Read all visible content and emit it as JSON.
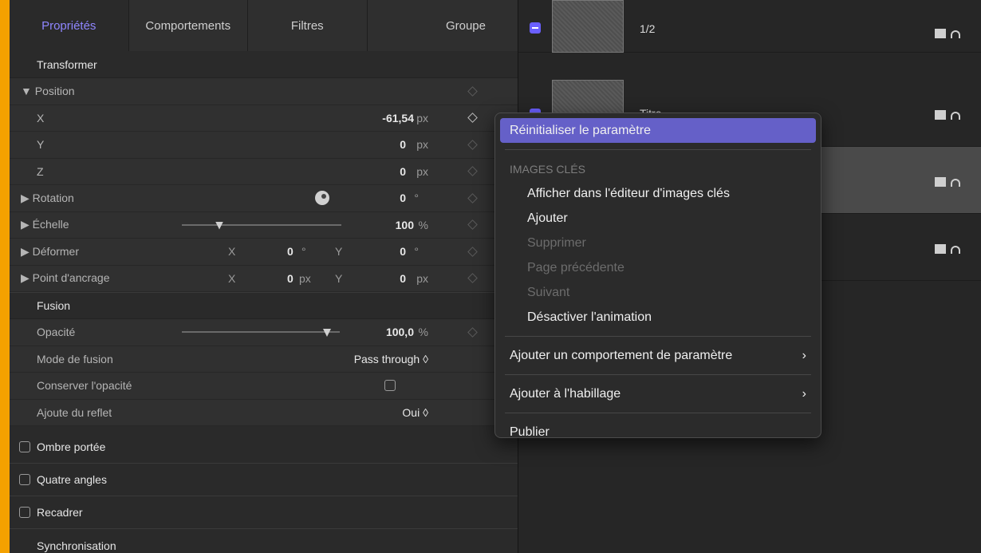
{
  "tabs": [
    "Propriétés",
    "Comportements",
    "Filtres",
    "Groupe"
  ],
  "inspector": {
    "transform_head": "Transformer",
    "position_label": "▼ Position",
    "x_label": "X",
    "x_value": "-61,54",
    "x_unit": "px",
    "y_label": "Y",
    "y_value": "0",
    "y_unit": "px",
    "z_label": "Z",
    "z_value": "0",
    "z_unit": "px",
    "rotation_label": "▶ Rotation",
    "rotation_value": "0",
    "rotation_unit": "°",
    "scale_label": "▶ Échelle",
    "scale_value": "100",
    "scale_unit": "%",
    "deform_label": "▶ Déformer",
    "deform_x_label": "X",
    "deform_x_value": "0",
    "deform_x_unit": "°",
    "deform_y_label": "Y",
    "deform_y_value": "0",
    "deform_y_unit": "°",
    "anchor_label": "▶ Point d'ancrage",
    "anchor_x_label": "X",
    "anchor_x_value": "0",
    "anchor_x_unit": "px",
    "anchor_y_label": "Y",
    "anchor_y_value": "0",
    "anchor_y_unit": "px",
    "fusion_head": "Fusion",
    "opacity_label": "Opacité",
    "opacity_value": "100,0",
    "opacity_unit": "%",
    "blend_label": "Mode de fusion",
    "blend_value": "Pass through ◊",
    "keep_opacity_label": "Conserver l'opacité",
    "reflection_label": "Ajoute du reflet",
    "reflection_value": "Oui ◊",
    "groups": [
      "Ombre portée",
      "Quatre angles",
      "Recadrer"
    ],
    "sync_label": "Synchronisation"
  },
  "layers": [
    {
      "name": "1/2"
    },
    {
      "name": "Titre"
    },
    {
      "name": ""
    },
    {
      "name": ""
    }
  ],
  "menu": {
    "reset": "Réinitialiser le paramètre",
    "keyframes_header": "IMAGES CLÉS",
    "show_editor": "Afficher dans l'éditeur d'images clés",
    "add": "Ajouter",
    "delete": "Supprimer",
    "prev": "Page précédente",
    "next": "Suivant",
    "disable_anim": "Désactiver l'animation",
    "add_behavior": "Ajouter un comportement de paramètre",
    "add_rig": "Ajouter à l'habillage",
    "publish": "Publier",
    "chevron": "›"
  },
  "colors": {
    "accent": "#6560c8",
    "frame": "#f4a100",
    "tab_active": "#8f86ff"
  }
}
